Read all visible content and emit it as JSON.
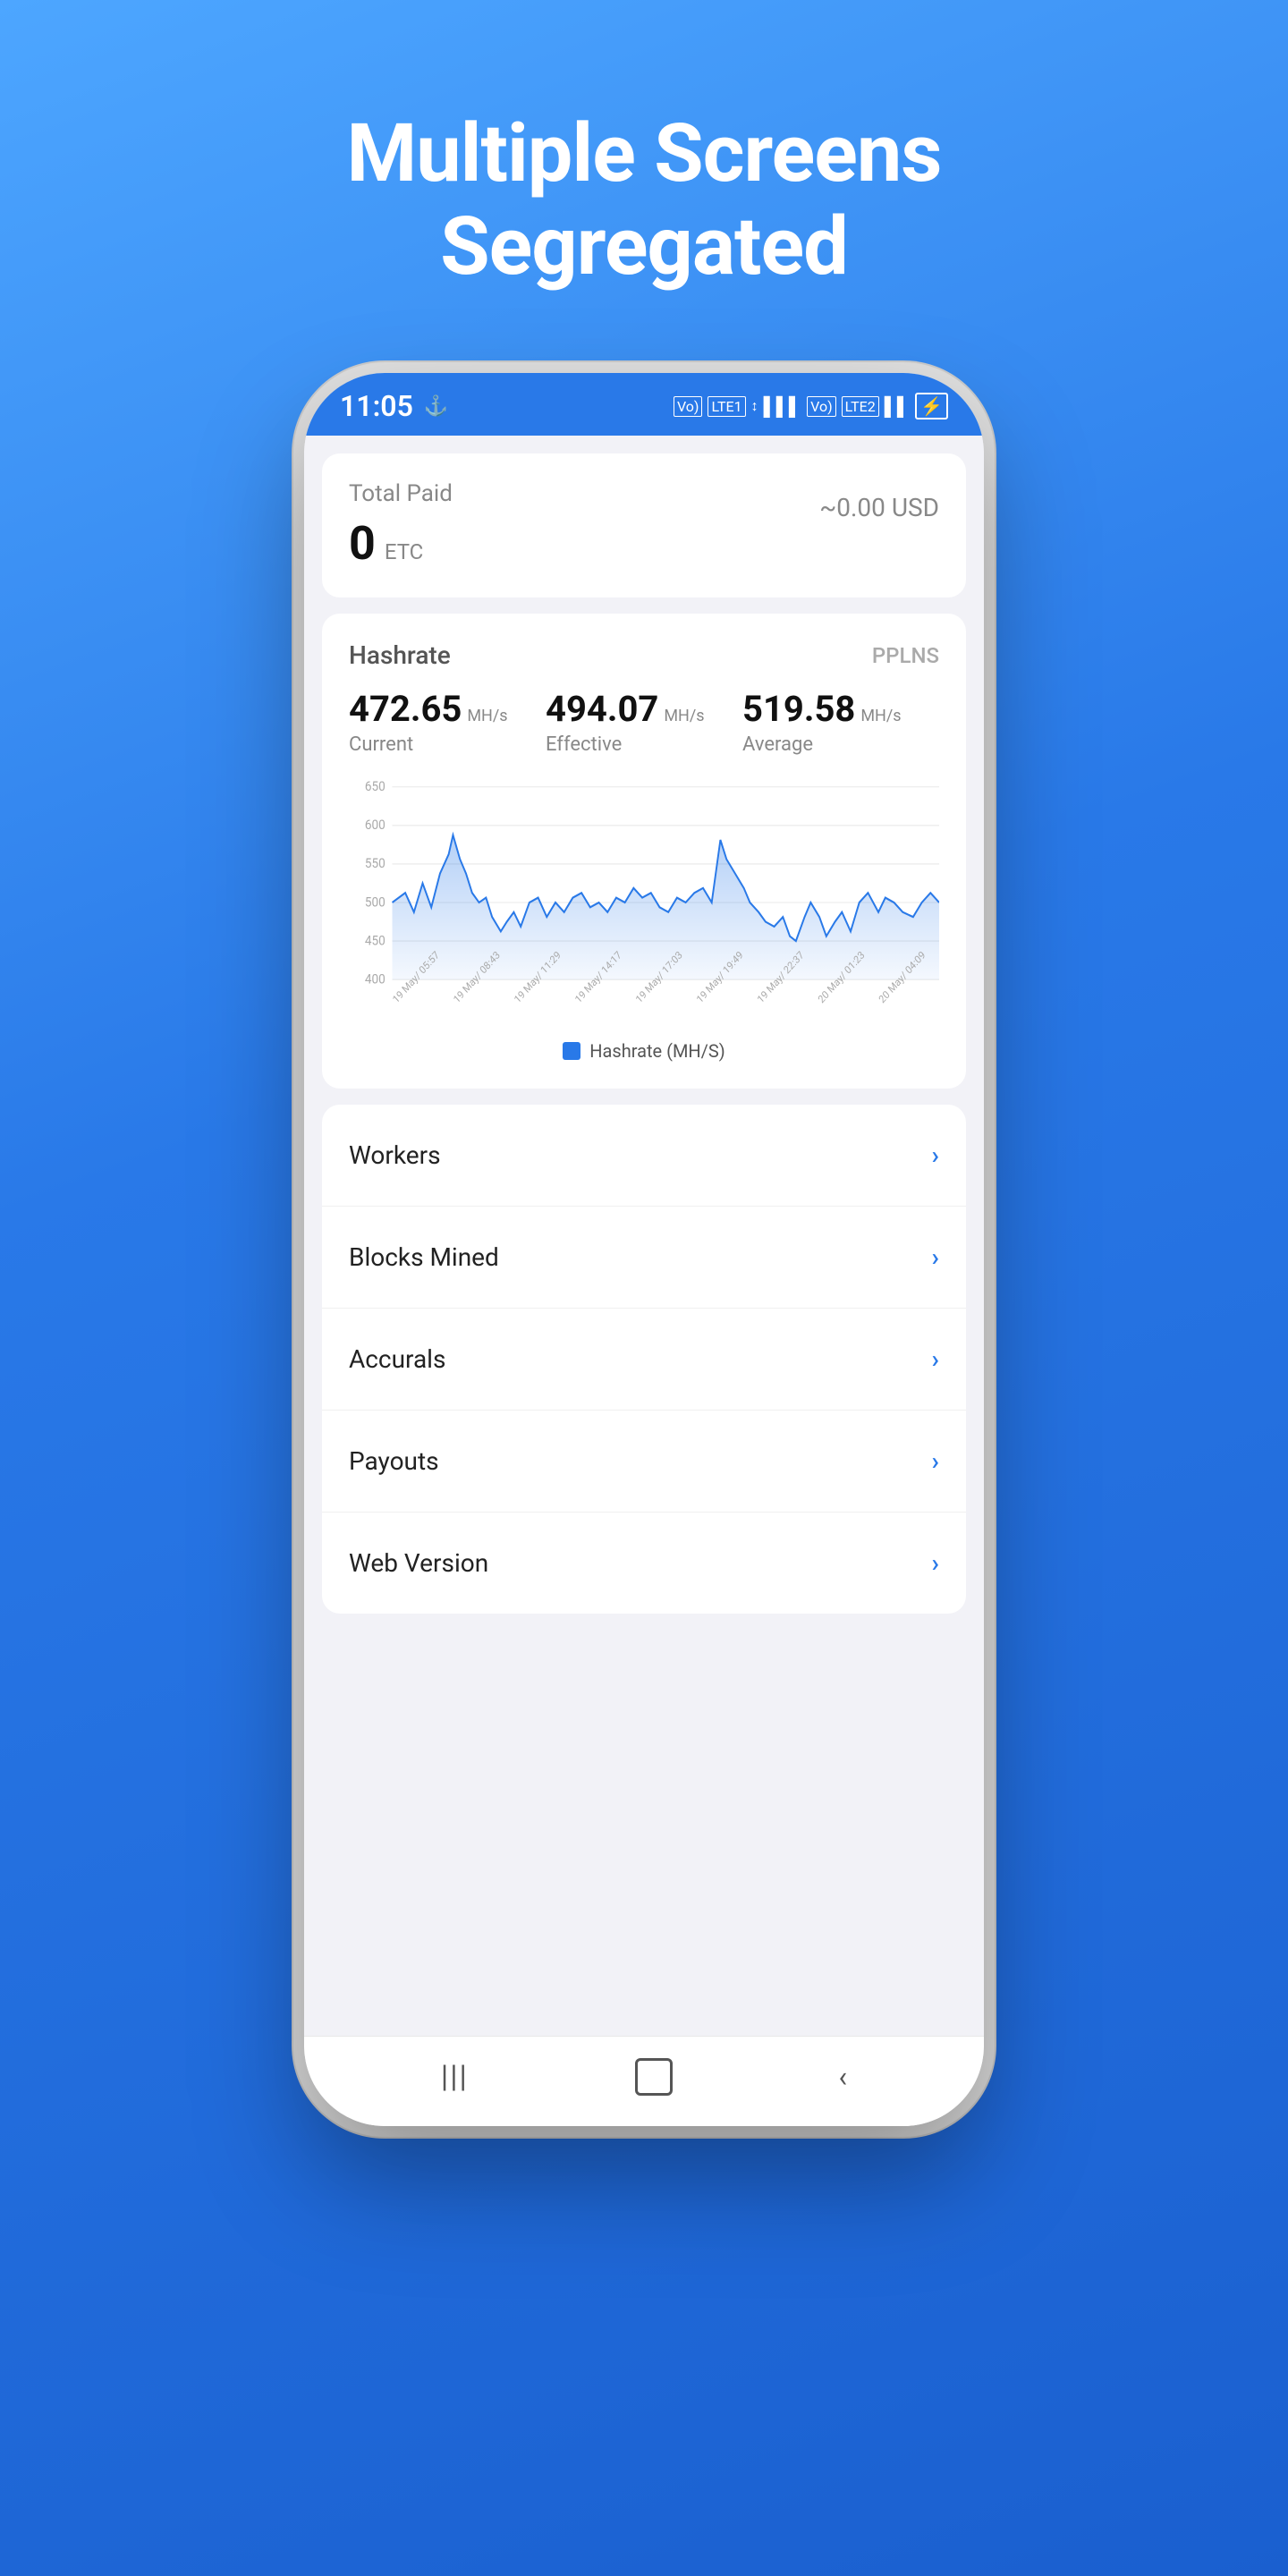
{
  "headline": {
    "line1": "Multiple Screens",
    "line2": "Segregated"
  },
  "status_bar": {
    "time": "11:05",
    "icons": "VoLTE1 LTE+ ↕ ▌▌ VoLTE2 ▌▌ 🔋"
  },
  "total_paid": {
    "label": "Total Paid",
    "value": "0",
    "unit": "ETC",
    "usd": "~0.00 USD"
  },
  "hashrate": {
    "title": "Hashrate",
    "mode": "PPLNS",
    "current_value": "472.65",
    "current_unit": "MH/s",
    "current_label": "Current",
    "effective_value": "494.07",
    "effective_unit": "MH/s",
    "effective_label": "Effective",
    "average_value": "519.58",
    "average_unit": "MH/s",
    "average_label": "Average",
    "y_labels": [
      "650",
      "600",
      "550",
      "500",
      "450",
      "400"
    ],
    "x_labels": [
      "19 May/ 05:57",
      "19 May/ 08:43",
      "19 May/ 11:29",
      "19 May/ 14:17",
      "19 May/ 17:03",
      "19 May/ 19:49",
      "19 May/ 22:37",
      "20 May/ 01:23",
      "20 May/ 04:09"
    ],
    "legend": "Hashrate (MH/S)"
  },
  "menu_items": [
    {
      "label": "Workers",
      "id": "workers"
    },
    {
      "label": "Blocks Mined",
      "id": "blocks-mined"
    },
    {
      "label": "Accurals",
      "id": "accurals"
    },
    {
      "label": "Payouts",
      "id": "payouts"
    },
    {
      "label": "Web Version",
      "id": "web-version"
    }
  ]
}
